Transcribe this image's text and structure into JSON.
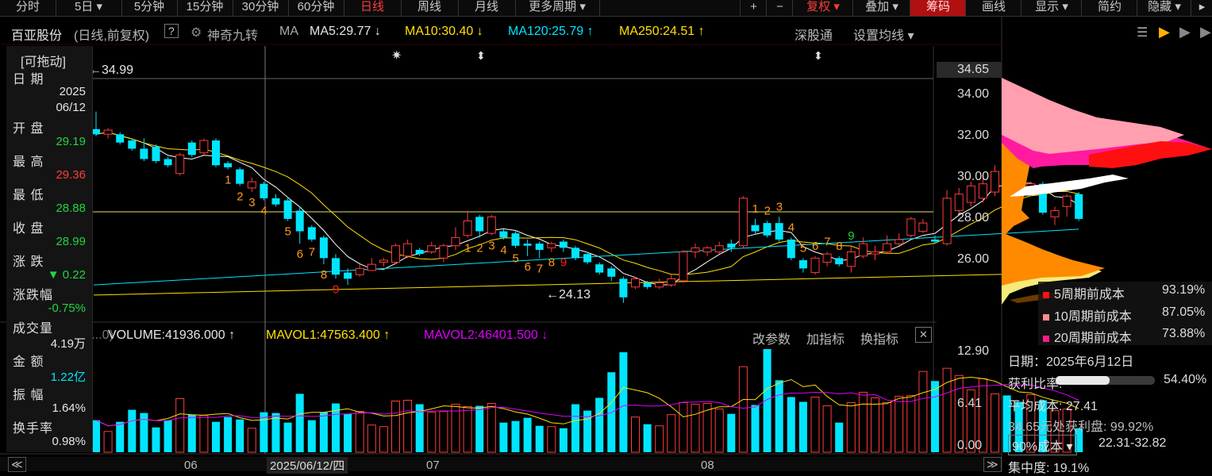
{
  "toolbar": {
    "periods": [
      "分时",
      "5日",
      "5分钟",
      "15分钟",
      "30分钟",
      "60分钟",
      "日线",
      "周线",
      "月线",
      "更多周期"
    ],
    "active_period": "日线",
    "right_buttons": [
      "复权",
      "叠加",
      "筹码",
      "画线",
      "显示",
      "简约",
      "隐藏"
    ],
    "plus": "+",
    "minus": "−"
  },
  "title": {
    "stock_name": "百亚股份",
    "mode": "(日线,前复权)",
    "help": "?",
    "tool_name": "神奇九转",
    "ma_label": "MA",
    "ma5": "MA5:29.77",
    "ma10": "MA10:30.40",
    "ma120": "MA120:25.79",
    "ma250": "MA250:24.51",
    "shenzhen_link": "深股通",
    "set_ma": "设置均线"
  },
  "info_panel": {
    "drag_label": "[可拖动]",
    "rows": [
      {
        "label": "日 期",
        "value": "2025",
        "value2": "06/12",
        "color": "white"
      },
      {
        "label": "开 盘",
        "value": "29.19",
        "color": "green"
      },
      {
        "label": "最 高",
        "value": "29.36",
        "color": "red"
      },
      {
        "label": "最 低",
        "value": "28.88",
        "color": "green"
      },
      {
        "label": "收 盘",
        "value": "28.99",
        "color": "green"
      },
      {
        "label": "涨 跌",
        "value": "▼ 0.22",
        "color": "green"
      },
      {
        "label": "涨跌幅",
        "value": "-0.75%",
        "color": "green"
      },
      {
        "label": "成交量",
        "value": "4.19万",
        "color": "white"
      },
      {
        "label": "金 额",
        "value": "1.22亿",
        "color": "cyan"
      },
      {
        "label": "振 幅",
        "value": "1.64%",
        "color": "white"
      },
      {
        "label": "换手率",
        "value": "0.98%",
        "color": "white"
      }
    ]
  },
  "price_axis": {
    "current_label": "34.65",
    "ticks": [
      "34.00",
      "32.00",
      "30.00",
      "28.00",
      "26.00"
    ]
  },
  "annotations": {
    "high": "34.99",
    "low": "24.13"
  },
  "volume": {
    "header_prefix": "(...0)",
    "volume": "VOLUME:41936.000",
    "mavol1": "MAVOL1:47563.400",
    "mavol2": "MAVOL2:46401.500",
    "buttons": [
      "改参数",
      "加指标",
      "换指标"
    ],
    "close": "✕",
    "axis": [
      "12.90",
      "6.41",
      "0.00"
    ]
  },
  "date_axis": {
    "months": [
      "06",
      "07",
      "08"
    ],
    "cursor_date": "2025/06/12/四"
  },
  "cost_panel": {
    "legend": [
      {
        "label": "5周期前成本",
        "value": "93.19%",
        "color": "#ff1010"
      },
      {
        "label": "10周期前成本",
        "value": "87.05%",
        "color": "#ff8a8a"
      },
      {
        "label": "20周期前成本",
        "value": "73.88%",
        "color": "#ff1a8c"
      }
    ],
    "date": "日期：2025年6月12日",
    "profit_ratio_label": "获利比率:",
    "profit_ratio_value": "54.40%",
    "profit_ratio": 0.544,
    "avg_cost": "平均成本: 27.41",
    "profit_at": "34.65元处获利盘: 99.92%",
    "cost_select": "90%成本 ▾",
    "cost_range": "22.31-32.82",
    "concentration": "集中度: 19.1%"
  },
  "chart_data": {
    "type": "candlestick",
    "price_ylim": [
      24.2,
      35.0
    ],
    "volume_ylim": [
      0,
      12.9
    ],
    "candles": [
      {
        "o": 32.55,
        "c": 32.3,
        "h": 33.4,
        "l": 32.2,
        "v": 4.0
      },
      {
        "o": 32.3,
        "c": 32.5,
        "h": 32.6,
        "l": 32.1,
        "v": 2.6
      },
      {
        "o": 32.3,
        "c": 31.9,
        "h": 32.4,
        "l": 31.8,
        "v": 3.8
      },
      {
        "o": 32.0,
        "c": 31.6,
        "h": 32.1,
        "l": 31.5,
        "v": 5.3
      },
      {
        "o": 31.6,
        "c": 31.1,
        "h": 32.1,
        "l": 31.0,
        "v": 4.9
      },
      {
        "o": 31.7,
        "c": 31.0,
        "h": 31.8,
        "l": 30.9,
        "v": 3.1
      },
      {
        "o": 31.1,
        "c": 30.8,
        "h": 31.2,
        "l": 30.7,
        "v": 4.0
      },
      {
        "o": 30.4,
        "c": 31.3,
        "h": 31.4,
        "l": 30.3,
        "v": 6.7
      },
      {
        "o": 31.9,
        "c": 31.3,
        "h": 32.0,
        "l": 31.2,
        "v": 4.7
      },
      {
        "o": 31.4,
        "c": 32.0,
        "h": 32.1,
        "l": 31.3,
        "v": 4.6
      },
      {
        "o": 32.0,
        "c": 30.8,
        "h": 32.1,
        "l": 30.7,
        "v": 3.8
      },
      {
        "o": 30.9,
        "c": 30.7,
        "h": 31.0,
        "l": 30.6,
        "v": 4.4
      },
      {
        "o": 30.6,
        "c": 29.9,
        "h": 30.7,
        "l": 29.8,
        "v": 4.1
      },
      {
        "o": 29.7,
        "c": 30.0,
        "h": 30.2,
        "l": 29.5,
        "v": 3.0
      },
      {
        "o": 29.9,
        "c": 29.2,
        "h": 30.0,
        "l": 29.1,
        "v": 5.0
      },
      {
        "o": 29.2,
        "c": 28.9,
        "h": 29.4,
        "l": 28.8,
        "v": 4.9
      },
      {
        "o": 29.1,
        "c": 28.2,
        "h": 29.2,
        "l": 28.1,
        "v": 3.7
      },
      {
        "o": 28.6,
        "c": 27.6,
        "h": 28.8,
        "l": 27.0,
        "v": 7.3
      },
      {
        "o": 27.8,
        "c": 27.2,
        "h": 27.9,
        "l": 27.1,
        "v": 4.0
      },
      {
        "o": 27.3,
        "c": 26.3,
        "h": 27.4,
        "l": 26.0,
        "v": 5.0
      },
      {
        "o": 26.3,
        "c": 25.5,
        "h": 26.5,
        "l": 25.3,
        "v": 6.1
      },
      {
        "o": 25.6,
        "c": 25.3,
        "h": 25.8,
        "l": 25.0,
        "v": 4.8
      },
      {
        "o": 25.5,
        "c": 25.8,
        "h": 26.0,
        "l": 25.4,
        "v": 5.1
      },
      {
        "o": 25.7,
        "c": 26.0,
        "h": 26.3,
        "l": 25.7,
        "v": 3.4
      },
      {
        "o": 26.1,
        "c": 26.2,
        "h": 26.3,
        "l": 25.9,
        "v": 3.2
      },
      {
        "o": 26.1,
        "c": 26.9,
        "h": 27.0,
        "l": 26.0,
        "v": 6.4
      },
      {
        "o": 26.4,
        "c": 27.0,
        "h": 27.2,
        "l": 26.3,
        "v": 6.5
      },
      {
        "o": 26.7,
        "c": 26.5,
        "h": 26.8,
        "l": 26.4,
        "v": 6.0
      },
      {
        "o": 26.6,
        "c": 26.9,
        "h": 27.1,
        "l": 26.5,
        "v": 5.0
      },
      {
        "o": 26.3,
        "c": 26.9,
        "h": 27.0,
        "l": 26.1,
        "v": 5.1
      },
      {
        "o": 26.9,
        "c": 27.3,
        "h": 27.8,
        "l": 26.7,
        "v": 6.0
      },
      {
        "o": 27.4,
        "c": 28.1,
        "h": 28.6,
        "l": 27.3,
        "v": 5.7
      },
      {
        "o": 28.3,
        "c": 27.6,
        "h": 28.4,
        "l": 27.3,
        "v": 5.8
      },
      {
        "o": 27.5,
        "c": 28.3,
        "h": 28.4,
        "l": 27.4,
        "v": 6.1
      },
      {
        "o": 27.6,
        "c": 27.3,
        "h": 27.7,
        "l": 27.2,
        "v": 3.7
      },
      {
        "o": 27.5,
        "c": 26.9,
        "h": 27.6,
        "l": 26.8,
        "v": 3.9
      },
      {
        "o": 27.0,
        "c": 26.9,
        "h": 27.2,
        "l": 26.4,
        "v": 4.3
      },
      {
        "o": 27.0,
        "c": 26.7,
        "h": 27.1,
        "l": 26.3,
        "v": 3.3
      },
      {
        "o": 26.8,
        "c": 27.0,
        "h": 27.1,
        "l": 26.6,
        "v": 3.2
      },
      {
        "o": 27.1,
        "c": 26.8,
        "h": 27.2,
        "l": 26.6,
        "v": 3.0
      },
      {
        "o": 26.8,
        "c": 26.3,
        "h": 26.9,
        "l": 26.2,
        "v": 6.0
      },
      {
        "o": 26.5,
        "c": 26.1,
        "h": 26.6,
        "l": 26.0,
        "v": 5.2
      },
      {
        "o": 26.0,
        "c": 25.6,
        "h": 26.1,
        "l": 25.5,
        "v": 6.8
      },
      {
        "o": 25.8,
        "c": 25.4,
        "h": 25.9,
        "l": 25.2,
        "v": 10.0
      },
      {
        "o": 25.3,
        "c": 24.4,
        "h": 25.4,
        "l": 24.13,
        "v": 12.5
      },
      {
        "o": 24.9,
        "c": 25.3,
        "h": 25.4,
        "l": 24.8,
        "v": 4.4
      },
      {
        "o": 25.1,
        "c": 24.9,
        "h": 25.2,
        "l": 24.8,
        "v": 3.5
      },
      {
        "o": 24.9,
        "c": 25.1,
        "h": 25.3,
        "l": 24.8,
        "v": 3.3
      },
      {
        "o": 25.0,
        "c": 25.3,
        "h": 25.5,
        "l": 24.9,
        "v": 4.7
      },
      {
        "o": 25.2,
        "c": 26.6,
        "h": 26.7,
        "l": 25.1,
        "v": 6.2
      },
      {
        "o": 26.6,
        "c": 26.8,
        "h": 27.0,
        "l": 26.3,
        "v": 6.0
      },
      {
        "o": 26.6,
        "c": 26.8,
        "h": 26.9,
        "l": 26.4,
        "v": 6.1
      },
      {
        "o": 26.6,
        "c": 26.9,
        "h": 27.1,
        "l": 26.5,
        "v": 5.4
      },
      {
        "o": 27.0,
        "c": 26.8,
        "h": 27.2,
        "l": 26.6,
        "v": 4.8
      },
      {
        "o": 26.9,
        "c": 29.2,
        "h": 29.3,
        "l": 26.8,
        "v": 10.7
      },
      {
        "o": 27.9,
        "c": 27.6,
        "h": 28.2,
        "l": 27.5,
        "v": 5.9
      },
      {
        "o": 28.0,
        "c": 27.4,
        "h": 28.1,
        "l": 27.3,
        "v": 12.9
      },
      {
        "o": 28.0,
        "c": 27.2,
        "h": 28.3,
        "l": 27.1,
        "v": 9.0
      },
      {
        "o": 27.2,
        "c": 26.3,
        "h": 27.3,
        "l": 26.2,
        "v": 6.9
      },
      {
        "o": 26.2,
        "c": 25.8,
        "h": 26.3,
        "l": 25.6,
        "v": 6.3
      },
      {
        "o": 25.6,
        "c": 26.3,
        "h": 26.4,
        "l": 25.5,
        "v": 6.9
      },
      {
        "o": 26.1,
        "c": 26.5,
        "h": 26.6,
        "l": 25.9,
        "v": 5.8
      },
      {
        "o": 26.3,
        "c": 26.0,
        "h": 26.4,
        "l": 25.9,
        "v": 3.7
      },
      {
        "o": 25.9,
        "c": 26.6,
        "h": 26.9,
        "l": 25.6,
        "v": 6.2
      },
      {
        "o": 26.4,
        "c": 27.0,
        "h": 27.3,
        "l": 26.3,
        "v": 7.5
      },
      {
        "o": 26.5,
        "c": 26.6,
        "h": 26.9,
        "l": 26.2,
        "v": 6.8
      },
      {
        "o": 26.6,
        "c": 27.0,
        "h": 27.4,
        "l": 26.5,
        "v": 6.2
      },
      {
        "o": 27.0,
        "c": 27.2,
        "h": 27.5,
        "l": 26.9,
        "v": 7.0
      },
      {
        "o": 27.4,
        "c": 28.2,
        "h": 28.3,
        "l": 27.3,
        "v": 7.1
      },
      {
        "o": 27.6,
        "c": 28.0,
        "h": 28.2,
        "l": 27.5,
        "v": 10.1
      },
      {
        "o": 27.2,
        "c": 27.1,
        "h": 27.4,
        "l": 27.0,
        "v": 8.9
      },
      {
        "o": 27.0,
        "c": 29.2,
        "h": 29.6,
        "l": 26.9,
        "v": 10.5
      },
      {
        "o": 28.6,
        "c": 29.4,
        "h": 29.7,
        "l": 28.5,
        "v": 9.6
      },
      {
        "o": 29.0,
        "c": 29.8,
        "h": 30.0,
        "l": 28.8,
        "v": 7.8
      },
      {
        "o": 29.2,
        "c": 29.9,
        "h": 30.3,
        "l": 29.0,
        "v": 9.2
      },
      {
        "o": 29.5,
        "c": 30.5,
        "h": 30.8,
        "l": 29.3,
        "v": 7.3
      },
      {
        "o": 30.4,
        "c": 29.6,
        "h": 31.0,
        "l": 29.5,
        "v": 7.1
      },
      {
        "o": 30.2,
        "c": 29.8,
        "h": 30.4,
        "l": 29.5,
        "v": 6.3
      },
      {
        "o": 29.6,
        "c": 29.9,
        "h": 30.0,
        "l": 29.3,
        "v": 7.2
      },
      {
        "o": 29.9,
        "c": 28.5,
        "h": 30.0,
        "l": 28.4,
        "v": 6.5
      },
      {
        "o": 28.3,
        "c": 28.6,
        "h": 28.8,
        "l": 27.9,
        "v": 5.2
      },
      {
        "o": 28.8,
        "c": 29.3,
        "h": 29.4,
        "l": 28.3,
        "v": 5.4
      },
      {
        "o": 29.4,
        "c": 28.2,
        "h": 29.5,
        "l": 28.1,
        "v": 3.0
      }
    ],
    "nine_turn_labels": [
      {
        "i": 11,
        "t": "1",
        "c": "#ff9a1a",
        "above": false
      },
      {
        "i": 12,
        "t": "2",
        "c": "#ff9a1a",
        "above": false
      },
      {
        "i": 13,
        "t": "3",
        "c": "#ff9a1a",
        "above": false
      },
      {
        "i": 14,
        "t": "4",
        "c": "#ff9a1a",
        "above": false
      },
      {
        "i": 16,
        "t": "5",
        "c": "#ff9a1a",
        "above": false
      },
      {
        "i": 17,
        "t": "6",
        "c": "#ff9a1a",
        "above": false
      },
      {
        "i": 18,
        "t": "7",
        "c": "#ff9a1a",
        "above": false
      },
      {
        "i": 19,
        "t": "8",
        "c": "#ff9a1a",
        "above": false
      },
      {
        "i": 20,
        "t": "9",
        "c": "#ff2020",
        "above": false
      },
      {
        "i": 31,
        "t": "1",
        "c": "#ff9a1a",
        "above": false
      },
      {
        "i": 32,
        "t": "2",
        "c": "#ff9a1a",
        "above": false
      },
      {
        "i": 33,
        "t": "3",
        "c": "#ff9a1a",
        "above": false
      },
      {
        "i": 34,
        "t": "4",
        "c": "#ff9a1a",
        "above": false
      },
      {
        "i": 35,
        "t": "5",
        "c": "#ff9a1a",
        "above": false
      },
      {
        "i": 36,
        "t": "6",
        "c": "#ff9a1a",
        "above": false
      },
      {
        "i": 37,
        "t": "7",
        "c": "#ff9a1a",
        "above": false
      },
      {
        "i": 38,
        "t": "8",
        "c": "#ff9a1a",
        "above": false
      },
      {
        "i": 39,
        "t": "9",
        "c": "#ff2020",
        "above": false
      },
      {
        "i": 55,
        "t": "1",
        "c": "#ff9a1a",
        "above": true
      },
      {
        "i": 56,
        "t": "2",
        "c": "#ff9a1a",
        "above": true
      },
      {
        "i": 57,
        "t": "3",
        "c": "#ff9a1a",
        "above": true
      },
      {
        "i": 58,
        "t": "4",
        "c": "#ff9a1a",
        "above": true
      },
      {
        "i": 59,
        "t": "5",
        "c": "#ff9a1a",
        "above": true
      },
      {
        "i": 60,
        "t": "6",
        "c": "#ff9a1a",
        "above": true
      },
      {
        "i": 61,
        "t": "7",
        "c": "#ff9a1a",
        "above": true
      },
      {
        "i": 62,
        "t": "8",
        "c": "#ff9a1a",
        "above": true
      },
      {
        "i": 63,
        "t": "9",
        "c": "#1fd640",
        "above": true
      }
    ],
    "ma250": [
      24.51,
      25.6
    ],
    "ma120": [
      25.0,
      27.7
    ]
  }
}
